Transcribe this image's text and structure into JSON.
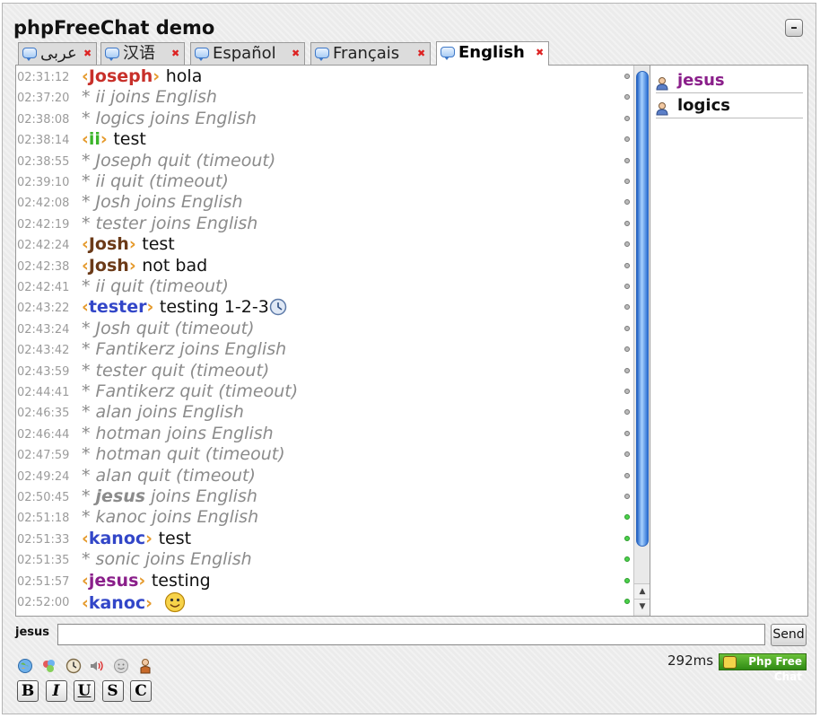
{
  "app": {
    "title": "phpFreeChat demo",
    "minimize_label": "–"
  },
  "tabs": [
    {
      "label": "عربى",
      "active": false
    },
    {
      "label": "汉语",
      "active": false
    },
    {
      "label": "Español",
      "active": false
    },
    {
      "label": "Français",
      "active": false
    },
    {
      "label": "English",
      "active": true
    }
  ],
  "messages": [
    {
      "time": "02:31:12",
      "type": "chat",
      "nick": "Joseph",
      "nick_color": "#c8302a",
      "text": "hola",
      "status": "gray"
    },
    {
      "time": "02:37:20",
      "type": "system",
      "text": "* ii joins English",
      "status": "gray"
    },
    {
      "time": "02:38:08",
      "type": "system",
      "text": "* logics joins English",
      "status": "gray"
    },
    {
      "time": "02:38:14",
      "type": "chat",
      "nick": "ii",
      "nick_color": "#3bb52a",
      "text": "test",
      "status": "gray"
    },
    {
      "time": "02:38:55",
      "type": "system",
      "text": "* Joseph quit (timeout)",
      "status": "gray"
    },
    {
      "time": "02:39:10",
      "type": "system",
      "text": "* ii quit (timeout)",
      "status": "gray"
    },
    {
      "time": "02:42:08",
      "type": "system",
      "text": "* Josh joins English",
      "status": "gray"
    },
    {
      "time": "02:42:19",
      "type": "system",
      "text": "* tester joins English",
      "status": "gray"
    },
    {
      "time": "02:42:24",
      "type": "chat",
      "nick": "Josh",
      "nick_color": "#6b3a18",
      "text": "test",
      "status": "gray"
    },
    {
      "time": "02:42:38",
      "type": "chat",
      "nick": "Josh",
      "nick_color": "#6b3a18",
      "text": "not bad",
      "status": "gray"
    },
    {
      "time": "02:42:41",
      "type": "system",
      "text": "* ii quit (timeout)",
      "status": "gray"
    },
    {
      "time": "02:43:22",
      "type": "chat",
      "nick": "tester",
      "nick_color": "#3246c8",
      "text": "testing 1-2-3",
      "status": "gray",
      "icon": "clock-icon"
    },
    {
      "time": "02:43:24",
      "type": "system",
      "text": "* Josh quit (timeout)",
      "status": "gray"
    },
    {
      "time": "02:43:42",
      "type": "system",
      "text": "* Fantikerz joins English",
      "status": "gray"
    },
    {
      "time": "02:43:59",
      "type": "system",
      "text": "* tester quit (timeout)",
      "status": "gray"
    },
    {
      "time": "02:44:41",
      "type": "system",
      "text": "* Fantikerz quit (timeout)",
      "status": "gray"
    },
    {
      "time": "02:46:35",
      "type": "system",
      "text": "* alan joins English",
      "status": "gray"
    },
    {
      "time": "02:46:44",
      "type": "system",
      "text": "* hotman joins English",
      "status": "gray"
    },
    {
      "time": "02:47:59",
      "type": "system",
      "text": "* hotman quit (timeout)",
      "status": "gray"
    },
    {
      "time": "02:49:24",
      "type": "system",
      "text": "* alan quit (timeout)",
      "status": "gray"
    },
    {
      "time": "02:50:45",
      "type": "system",
      "prefix": "* ",
      "bold": "jesus",
      "text": " joins English",
      "status": "gray"
    },
    {
      "time": "02:51:18",
      "type": "system",
      "text": "* kanoc joins English",
      "status": "green"
    },
    {
      "time": "02:51:33",
      "type": "chat",
      "nick": "kanoc",
      "nick_color": "#3246c8",
      "text": "test",
      "status": "green"
    },
    {
      "time": "02:51:35",
      "type": "system",
      "text": "* sonic joins English",
      "status": "green"
    },
    {
      "time": "02:51:57",
      "type": "chat",
      "nick": "jesus",
      "nick_color": "#8a1f8a",
      "text": "testing",
      "status": "green"
    },
    {
      "time": "02:52:00",
      "type": "chat",
      "nick": "kanoc",
      "nick_color": "#3246c8",
      "text": "",
      "status": "green",
      "icon": "smiley-icon"
    }
  ],
  "users": [
    {
      "name": "jesus",
      "color": "#8a1f8a"
    },
    {
      "name": "logics",
      "color": "#111111"
    }
  ],
  "input": {
    "nick_label": "jesus",
    "value": "",
    "send_label": "Send"
  },
  "toolbar": {
    "icons": [
      "globe-icon",
      "users-icon",
      "clock-icon",
      "sound-icon",
      "smiley-icon",
      "person-icon"
    ],
    "format_buttons": [
      "B",
      "I",
      "U",
      "S",
      "C"
    ]
  },
  "status": {
    "ping": "292ms",
    "badge_label": "Php Free Chat"
  }
}
